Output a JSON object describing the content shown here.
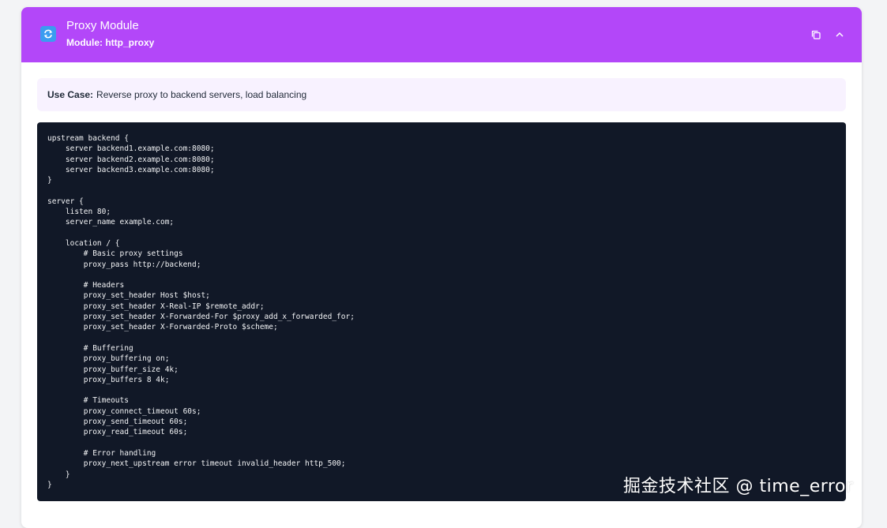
{
  "header": {
    "title": "Proxy Module",
    "subtitle": "Module: http_proxy",
    "icon": "refresh-icon",
    "actions": [
      {
        "name": "copy-icon"
      },
      {
        "name": "chevron-up-icon"
      }
    ],
    "colors": {
      "header_bg": "#b347f9",
      "icon_bg": "#3b9cf0"
    }
  },
  "use_case": {
    "label": "Use Case:",
    "text": "Reverse proxy to backend servers, load balancing"
  },
  "code": {
    "content": "upstream backend {\n    server backend1.example.com:8080;\n    server backend2.example.com:8080;\n    server backend3.example.com:8080;\n}\n\nserver {\n    listen 80;\n    server_name example.com;\n\n    location / {\n        # Basic proxy settings\n        proxy_pass http://backend;\n\n        # Headers\n        proxy_set_header Host $host;\n        proxy_set_header X-Real-IP $remote_addr;\n        proxy_set_header X-Forwarded-For $proxy_add_x_forwarded_for;\n        proxy_set_header X-Forwarded-Proto $scheme;\n\n        # Buffering\n        proxy_buffering on;\n        proxy_buffer_size 4k;\n        proxy_buffers 8 4k;\n\n        # Timeouts\n        proxy_connect_timeout 60s;\n        proxy_send_timeout 60s;\n        proxy_read_timeout 60s;\n\n        # Error handling\n        proxy_next_upstream error timeout invalid_header http_500;\n    }\n}"
  },
  "watermark": {
    "text": "掘金技术社区 @ time_error"
  }
}
